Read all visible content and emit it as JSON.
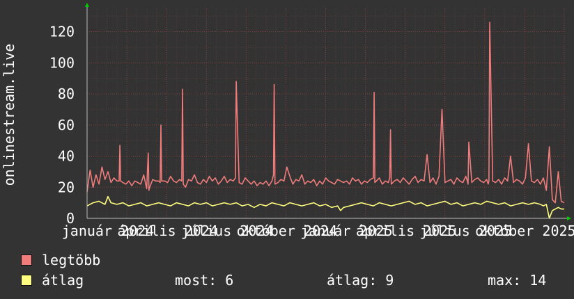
{
  "chart_data": {
    "type": "line",
    "ylabel": "onlinestream.live",
    "ylim": [
      0,
      135
    ],
    "yticks": [
      0,
      20,
      40,
      60,
      80,
      100,
      120
    ],
    "xticks": [
      "január 2024",
      "április 2024",
      "július 2024",
      "október 2024",
      "január 2025",
      "április 2025",
      "július 2025",
      "október 2025"
    ],
    "xlim": [
      0,
      640
    ],
    "grid": true,
    "series": [
      {
        "name": "legtöbb",
        "color": "#f07c7c",
        "x": [
          0,
          4,
          8,
          12,
          16,
          20,
          24,
          28,
          32,
          36,
          40,
          43,
          44,
          45,
          48,
          52,
          56,
          60,
          64,
          68,
          72,
          76,
          80,
          82,
          83,
          84,
          88,
          92,
          96,
          98,
          99,
          100,
          104,
          108,
          112,
          116,
          120,
          124,
          127,
          128,
          129,
          132,
          136,
          140,
          144,
          148,
          152,
          156,
          160,
          164,
          168,
          172,
          176,
          180,
          184,
          188,
          192,
          196,
          199,
          200,
          201,
          204,
          208,
          212,
          216,
          220,
          224,
          228,
          232,
          236,
          240,
          244,
          248,
          250,
          251,
          252,
          256,
          260,
          264,
          268,
          272,
          276,
          280,
          284,
          288,
          292,
          296,
          300,
          304,
          308,
          312,
          316,
          320,
          324,
          328,
          332,
          336,
          340,
          344,
          348,
          352,
          356,
          360,
          364,
          368,
          372,
          376,
          380,
          384,
          385,
          386,
          388,
          392,
          396,
          400,
          404,
          406,
          407,
          408,
          412,
          416,
          420,
          424,
          428,
          432,
          436,
          440,
          444,
          448,
          452,
          456,
          460,
          464,
          468,
          472,
          476,
          480,
          484,
          488,
          492,
          496,
          500,
          504,
          508,
          510,
          511,
          512,
          516,
          520,
          524,
          528,
          532,
          536,
          538,
          539,
          540,
          544,
          548,
          552,
          556,
          560,
          564,
          568,
          572,
          576,
          580,
          584,
          588,
          592,
          596,
          600,
          604,
          608,
          612,
          616,
          620,
          624,
          628,
          632,
          636,
          640
        ],
        "y": [
          17,
          31,
          20,
          28,
          22,
          33,
          25,
          30,
          23,
          26,
          24,
          24,
          47,
          24,
          23,
          22,
          24,
          21,
          24,
          23,
          22,
          28,
          19,
          42,
          18,
          20,
          25,
          24,
          24,
          23,
          60,
          24,
          24,
          23,
          27,
          24,
          23,
          25,
          24,
          83,
          22,
          20,
          25,
          24,
          28,
          23,
          22,
          25,
          23,
          27,
          24,
          26,
          22,
          24,
          27,
          23,
          25,
          24,
          26,
          88,
          72,
          23,
          22,
          26,
          24,
          22,
          24,
          21,
          23,
          22,
          24,
          21,
          24,
          28,
          86,
          22,
          23,
          25,
          24,
          33,
          27,
          22,
          25,
          24,
          28,
          22,
          24,
          23,
          25,
          21,
          24,
          22,
          26,
          24,
          23,
          22,
          25,
          24,
          23,
          24,
          22,
          26,
          24,
          25,
          22,
          24,
          23,
          25,
          26,
          81,
          23,
          24,
          26,
          22,
          24,
          23,
          26,
          57,
          22,
          24,
          25,
          23,
          26,
          24,
          22,
          25,
          27,
          23,
          25,
          24,
          41,
          23,
          26,
          22,
          27,
          70,
          23,
          24,
          25,
          22,
          26,
          24,
          23,
          27,
          24,
          22,
          49,
          23,
          25,
          26,
          24,
          23,
          25,
          22,
          24,
          126,
          24,
          23,
          25,
          22,
          26,
          24,
          40,
          23,
          25,
          24,
          22,
          26,
          48,
          24,
          23,
          25,
          22,
          26,
          18,
          46,
          12,
          10,
          30,
          11,
          10
        ],
        "current": 12,
        "average": 22,
        "max": 126
      },
      {
        "name": "átlag",
        "color": "#ffff80",
        "x": [
          0,
          8,
          16,
          24,
          28,
          32,
          40,
          48,
          56,
          64,
          72,
          80,
          88,
          96,
          104,
          112,
          120,
          128,
          136,
          144,
          152,
          160,
          168,
          176,
          184,
          192,
          200,
          208,
          216,
          224,
          232,
          240,
          248,
          256,
          264,
          272,
          280,
          288,
          296,
          304,
          312,
          320,
          328,
          336,
          340,
          344,
          352,
          360,
          368,
          376,
          384,
          392,
          400,
          408,
          416,
          424,
          432,
          440,
          448,
          456,
          464,
          472,
          480,
          488,
          496,
          504,
          512,
          520,
          528,
          536,
          544,
          552,
          560,
          568,
          576,
          584,
          592,
          600,
          608,
          612,
          616,
          620,
          624,
          628,
          632,
          636,
          640
        ],
        "y": [
          8,
          10,
          11,
          9,
          14,
          10,
          9,
          10,
          8,
          9,
          10,
          8,
          9,
          10,
          9,
          8,
          10,
          9,
          8,
          10,
          9,
          10,
          8,
          9,
          10,
          9,
          10,
          8,
          9,
          7,
          9,
          8,
          10,
          9,
          8,
          10,
          9,
          8,
          9,
          10,
          8,
          9,
          7,
          8,
          5,
          7,
          8,
          9,
          10,
          9,
          8,
          10,
          9,
          8,
          9,
          10,
          11,
          9,
          10,
          8,
          9,
          10,
          11,
          9,
          10,
          8,
          9,
          10,
          9,
          11,
          10,
          9,
          10,
          8,
          9,
          10,
          9,
          10,
          9,
          8,
          9,
          0,
          5,
          6,
          7,
          6,
          6
        ],
        "current": 6,
        "average": 9,
        "max": 14
      }
    ]
  },
  "legend": {
    "max_label": "legtöbb",
    "avg_label": "átlag",
    "stats": {
      "now_label": "most:",
      "now_value": "6",
      "avg_label": "átlag:",
      "avg_value": "9",
      "max_label": "max:",
      "max_value": "14"
    }
  }
}
